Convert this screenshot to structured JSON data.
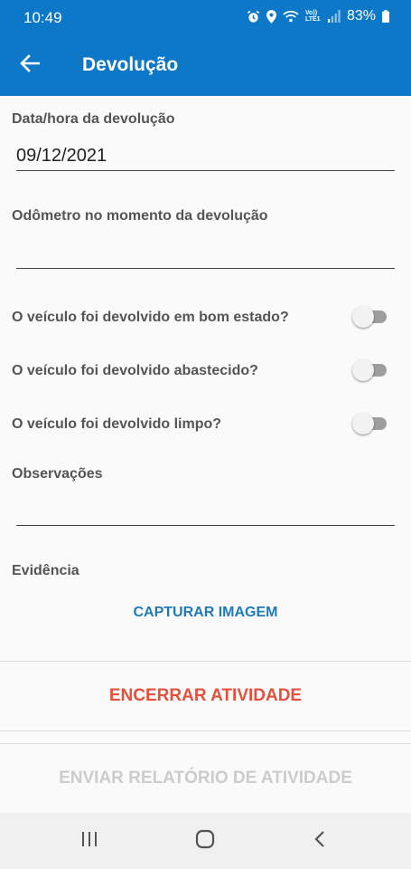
{
  "status_bar": {
    "time": "10:49",
    "battery": "83%",
    "network_label": "Vo)) LTE1"
  },
  "app_bar": {
    "title": "Devolução",
    "back_icon": "arrow-left-icon"
  },
  "form": {
    "return_datetime": {
      "label": "Data/hora da devolução",
      "value": "09/12/2021"
    },
    "odometer": {
      "label": "Odômetro no momento da devolução",
      "value": ""
    },
    "toggles": [
      {
        "label": "O veículo foi devolvido em bom estado?",
        "checked": false
      },
      {
        "label": "O veículo foi devolvido abastecido?",
        "checked": false
      },
      {
        "label": "O veículo foi devolvido limpo?",
        "checked": false
      }
    ],
    "notes": {
      "label": "Observações",
      "value": ""
    },
    "evidence": {
      "label": "Evidência",
      "capture_label": "CAPTURAR IMAGEM"
    }
  },
  "actions": {
    "end_activity": "ENCERRAR ATIVIDADE",
    "send_report": "ENVIAR RELATÓRIO DE ATIVIDADE"
  },
  "colors": {
    "primary": "#0d78c7",
    "accent_link": "#1e7bb8",
    "danger": "#e4503c",
    "disabled": "#cccccc"
  }
}
